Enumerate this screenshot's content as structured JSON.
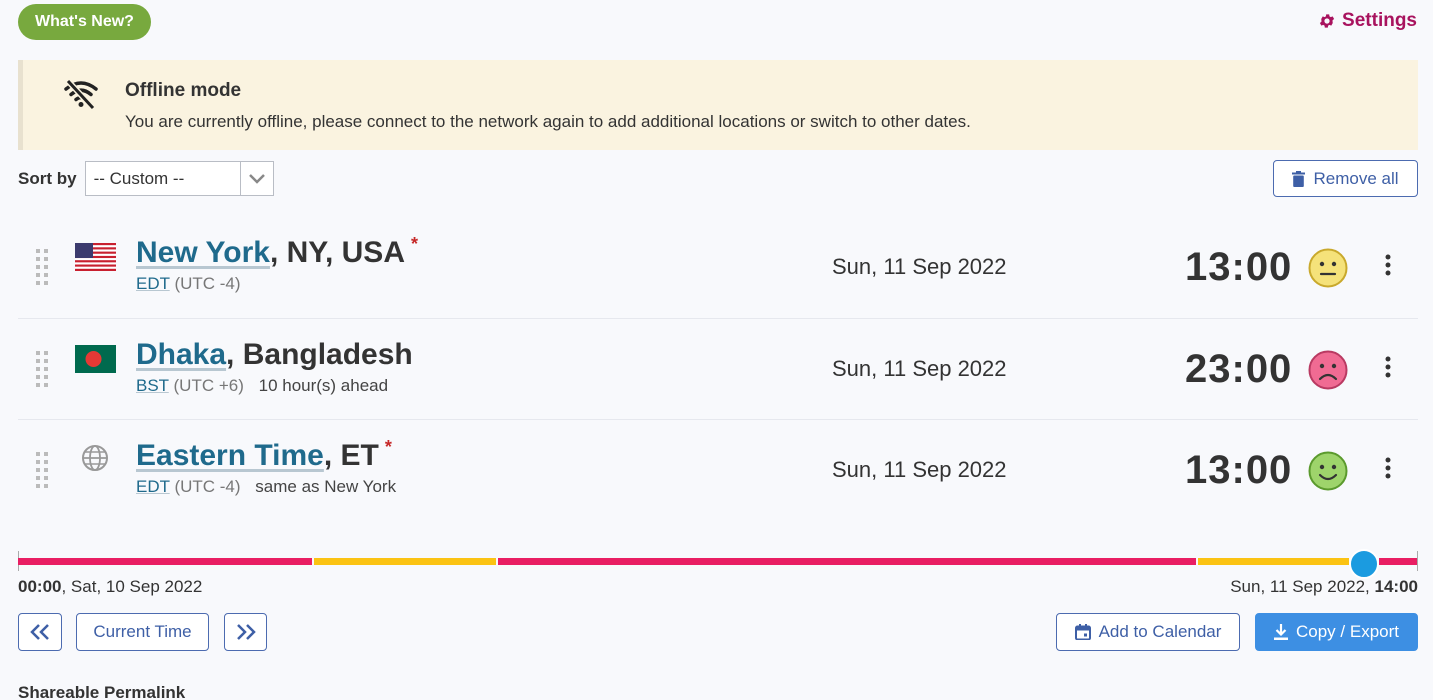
{
  "header": {
    "whats_new_label": "What's New?",
    "settings_label": "Settings"
  },
  "offline": {
    "title": "Offline mode",
    "message": "You are currently offline, please connect to the network again to add additional locations or switch to other dates."
  },
  "sort": {
    "label": "Sort by",
    "selected": "-- Custom --"
  },
  "remove_all_label": "Remove all",
  "locations": [
    {
      "city": "New York",
      "region": ", NY, USA",
      "starred": "*",
      "tz_abbr": "EDT",
      "tz_utc": "(UTC -4)",
      "relative": "",
      "date": "Sun, 11 Sep 2022",
      "time": "13:00",
      "mood": "neutral",
      "flag": "us-flag-icon"
    },
    {
      "city": "Dhaka",
      "region": ", Bangladesh",
      "starred": "",
      "tz_abbr": "BST",
      "tz_utc": "(UTC +6)",
      "relative": "10 hour(s) ahead",
      "date": "Sun, 11 Sep 2022",
      "time": "23:00",
      "mood": "sad",
      "flag": "bangladesh-flag-icon"
    },
    {
      "city": "Eastern Time",
      "region": ", ET",
      "starred": "*",
      "tz_abbr": "EDT",
      "tz_utc": "(UTC -4)",
      "relative": "same as New York",
      "date": "Sun, 11 Sep 2022",
      "time": "13:00",
      "mood": "happy",
      "flag": "globe-icon"
    }
  ],
  "timeline": {
    "start_time": "00:00",
    "start_date": ", Sat, 10 Sep 2022",
    "end_date": "Sun, 11 Sep 2022, ",
    "end_time": "14:00",
    "colors": {
      "bad": "#e91e63",
      "ok": "#fbc313",
      "knob": "#1b9be0"
    }
  },
  "buttons": {
    "current_time": "Current Time",
    "add_to_calendar": "Add to Calendar",
    "copy_export": "Copy / Export"
  },
  "permalink_label": "Shareable Permalink"
}
